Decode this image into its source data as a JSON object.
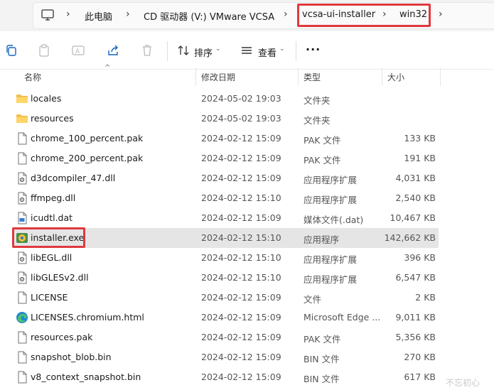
{
  "address": {
    "crumbs": [
      "此电脑",
      "CD 驱动器 (V:) VMware VCSA",
      "vcsa-ui-installer",
      "win32"
    ],
    "separator": "›",
    "highlight_color": "#e0393e"
  },
  "toolbar": {
    "sort_label": "排序",
    "view_label": "查看",
    "more_label": "···"
  },
  "columns": {
    "name": "名称",
    "date": "修改日期",
    "type": "类型",
    "size": "大小"
  },
  "files": [
    {
      "name": "locales",
      "date": "2024-05-02 19:03",
      "type": "文件夹",
      "size": "",
      "icon": "folder-icon"
    },
    {
      "name": "resources",
      "date": "2024-05-02 19:03",
      "type": "文件夹",
      "size": "",
      "icon": "folder-icon"
    },
    {
      "name": "chrome_100_percent.pak",
      "date": "2024-02-12 15:09",
      "type": "PAK 文件",
      "size": "133 KB",
      "icon": "file-icon"
    },
    {
      "name": "chrome_200_percent.pak",
      "date": "2024-02-12 15:09",
      "type": "PAK 文件",
      "size": "191 KB",
      "icon": "file-icon"
    },
    {
      "name": "d3dcompiler_47.dll",
      "date": "2024-02-12 15:09",
      "type": "应用程序扩展",
      "size": "4,031 KB",
      "icon": "dll-icon"
    },
    {
      "name": "ffmpeg.dll",
      "date": "2024-02-12 15:10",
      "type": "应用程序扩展",
      "size": "2,540 KB",
      "icon": "dll-icon"
    },
    {
      "name": "icudtl.dat",
      "date": "2024-02-12 15:09",
      "type": "媒体文件(.dat)",
      "size": "10,467 KB",
      "icon": "media-file-icon"
    },
    {
      "name": "installer.exe",
      "date": "2024-02-12 15:10",
      "type": "应用程序",
      "size": "142,662 KB",
      "icon": "exe-icon",
      "selected": true
    },
    {
      "name": "libEGL.dll",
      "date": "2024-02-12 15:10",
      "type": "应用程序扩展",
      "size": "396 KB",
      "icon": "dll-icon"
    },
    {
      "name": "libGLESv2.dll",
      "date": "2024-02-12 15:10",
      "type": "应用程序扩展",
      "size": "6,547 KB",
      "icon": "dll-icon"
    },
    {
      "name": "LICENSE",
      "date": "2024-02-12 15:09",
      "type": "文件",
      "size": "2 KB",
      "icon": "file-icon"
    },
    {
      "name": "LICENSES.chromium.html",
      "date": "2024-02-12 15:09",
      "type": "Microsoft Edge ...",
      "size": "9,011 KB",
      "icon": "edge-icon"
    },
    {
      "name": "resources.pak",
      "date": "2024-02-12 15:09",
      "type": "PAK 文件",
      "size": "5,356 KB",
      "icon": "file-icon"
    },
    {
      "name": "snapshot_blob.bin",
      "date": "2024-02-12 15:09",
      "type": "BIN 文件",
      "size": "270 KB",
      "icon": "file-icon"
    },
    {
      "name": "v8_context_snapshot.bin",
      "date": "2024-02-12 15:09",
      "type": "BIN 文件",
      "size": "617 KB",
      "icon": "file-icon"
    }
  ],
  "watermark": "不忘初心"
}
